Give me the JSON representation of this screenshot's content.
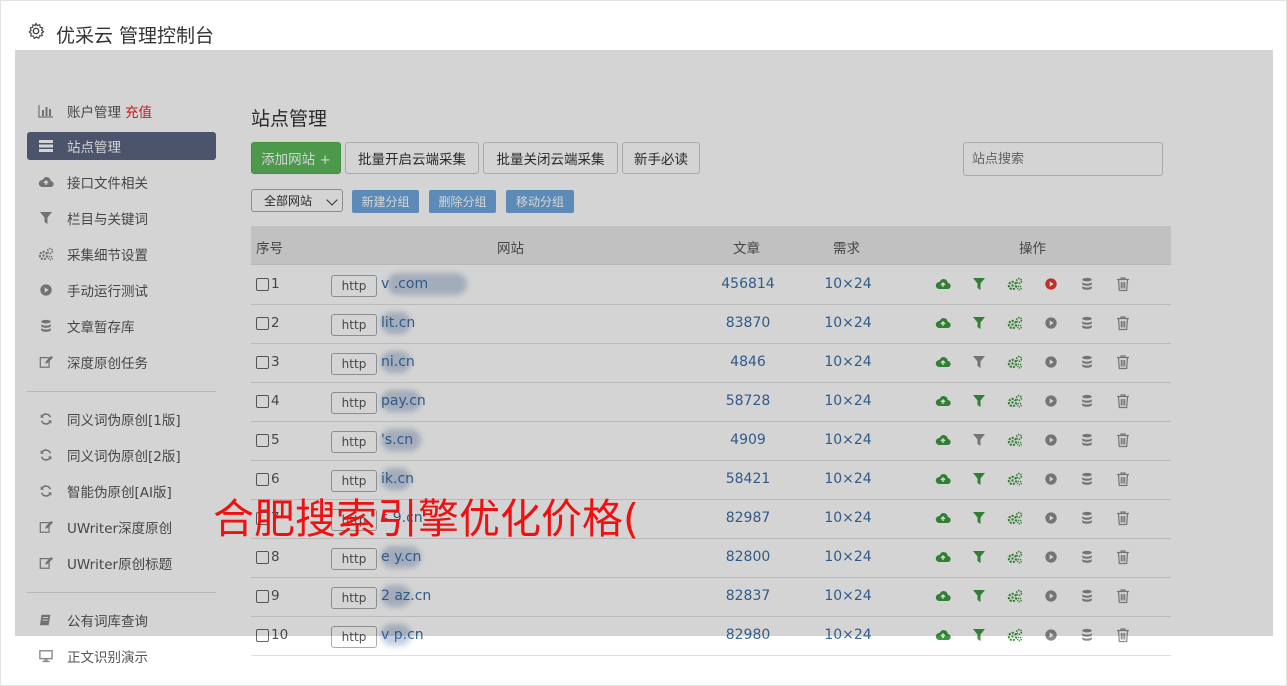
{
  "header": {
    "title": "优采云 管理控制台",
    "icon": "gear-icon"
  },
  "sidebar": {
    "items": [
      {
        "label": "账户管理",
        "badge": "充值",
        "icon": "bar-chart-icon"
      },
      {
        "label": "站点管理",
        "icon": "list-icon",
        "active": true
      },
      {
        "label": "接口文件相关",
        "icon": "cloud-upload-icon"
      },
      {
        "label": "栏目与关键词",
        "icon": "filter-icon"
      },
      {
        "label": "采集细节设置",
        "icon": "cogs-icon"
      },
      {
        "label": "手动运行测试",
        "icon": "play-circle-icon"
      },
      {
        "label": "文章暂存库",
        "icon": "database-icon"
      },
      {
        "label": "深度原创任务",
        "icon": "edit-icon"
      },
      {
        "label": "同义词伪原创[1版]",
        "icon": "refresh-icon"
      },
      {
        "label": "同义词伪原创[2版]",
        "icon": "refresh-icon"
      },
      {
        "label": "智能伪原创[AI版]",
        "icon": "refresh-icon"
      },
      {
        "label": "UWriter深度原创",
        "icon": "edit-icon"
      },
      {
        "label": "UWriter原创标题",
        "icon": "edit-icon"
      },
      {
        "label": "公有词库查询",
        "icon": "book-icon"
      },
      {
        "label": "正文识别演示",
        "icon": "monitor-icon"
      }
    ]
  },
  "main": {
    "title": "站点管理",
    "buttons": {
      "add": "添加网站 +",
      "batch_on": "批量开启云端采集",
      "batch_off": "批量关闭云端采集",
      "guide": "新手必读"
    },
    "search_placeholder": "站点搜索",
    "group_select": "全部网站",
    "group_buttons": {
      "new": "新建分组",
      "delete": "删除分组",
      "move": "移动分组"
    },
    "table": {
      "headers": {
        "index": "序号",
        "site": "网站",
        "articles": "文章",
        "demand": "需求",
        "ops": "操作"
      },
      "rows": [
        {
          "index": "1",
          "proto": "http",
          "site": "v .com",
          "articles": "456814",
          "demand": "10×24",
          "running": true
        },
        {
          "index": "2",
          "proto": "http",
          "site": "lit.cn",
          "articles": "83870",
          "demand": "10×24",
          "running": false
        },
        {
          "index": "3",
          "proto": "http",
          "site": "ni.cn",
          "articles": "4846",
          "demand": "10×24",
          "running": false
        },
        {
          "index": "4",
          "proto": "http",
          "site": "pay.cn",
          "articles": "58728",
          "demand": "10×24",
          "running": false
        },
        {
          "index": "5",
          "proto": "http",
          "site": "'s.cn",
          "articles": "4909",
          "demand": "10×24",
          "running": false
        },
        {
          "index": "6",
          "proto": "http",
          "site": "ik.cn",
          "articles": "58421",
          "demand": "10×24",
          "running": false
        },
        {
          "index": "7",
          "proto": "http",
          "site": "s 9.cn",
          "articles": "82987",
          "demand": "10×24",
          "running": false
        },
        {
          "index": "8",
          "proto": "http",
          "site": "e y.cn",
          "articles": "82800",
          "demand": "10×24",
          "running": false
        },
        {
          "index": "9",
          "proto": "http",
          "site": "2 az.cn",
          "articles": "82837",
          "demand": "10×24",
          "running": false
        },
        {
          "index": "10",
          "proto": "http",
          "site": "v p.cn",
          "articles": "82980",
          "demand": "10×24",
          "running": false
        }
      ]
    }
  },
  "watermark": "合肥搜索引擎优化价格(",
  "colors": {
    "accent": "#5b6580",
    "green": "#5cb85c",
    "link": "#3b6da5",
    "op_green": "#3c9a3c",
    "op_red": "#e53935",
    "op_gray": "#8c8c8c"
  }
}
